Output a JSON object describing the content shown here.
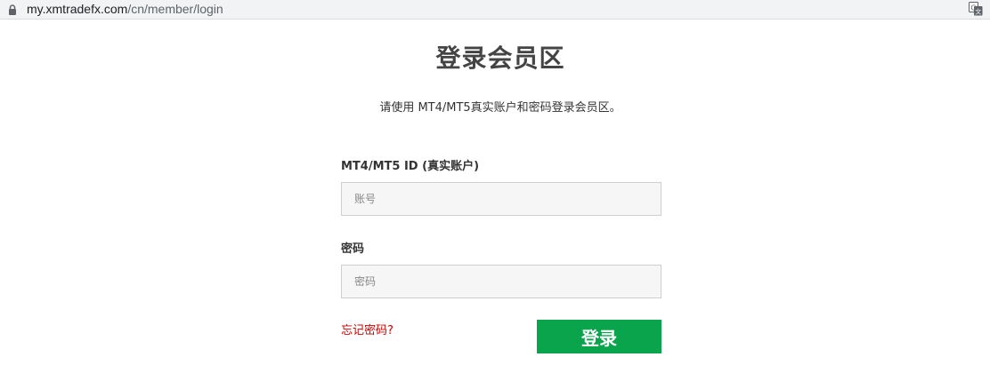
{
  "browser": {
    "url_host": "my.xmtradefx.com",
    "url_path": "/cn/member/login",
    "lock_icon": "lock-icon",
    "translate_icon": "google-translate-icon"
  },
  "page": {
    "title": "登录会员区",
    "subtitle": "请使用 MT4/MT5真实账户和密码登录会员区。"
  },
  "form": {
    "id_label": "MT4/MT5 ID (真实账户)",
    "id_placeholder": "账号",
    "password_label": "密码",
    "password_placeholder": "密码",
    "forgot_link": "忘记密码?",
    "login_button": "登录"
  },
  "colors": {
    "login_button": "#0aa44d",
    "forgot_link": "#d00000",
    "input_background": "#f6f6f6"
  }
}
